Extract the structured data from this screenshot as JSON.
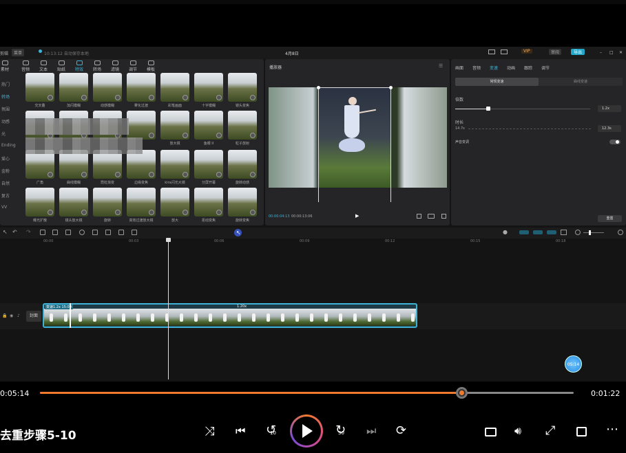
{
  "app": {
    "title": "4月8日",
    "menu": "剪辑",
    "menu_sub": "菜单",
    "autosave": "10:13:12 自动保存本地",
    "vip": "VIP",
    "share": "审阅",
    "export": "导出"
  },
  "library": {
    "tabs": [
      "素材",
      "音频",
      "文本",
      "贴纸",
      "特效",
      "转场",
      "滤镜",
      "调节",
      "模板"
    ],
    "active_tab": 4,
    "categories": [
      "热门",
      "转场",
      "氛围",
      "动感",
      "光",
      "Ending",
      "爱心",
      "金粉",
      "自然",
      "复古",
      "VV"
    ],
    "active_category": 1,
    "rows": [
      [
        "交叉叠",
        "加闪模糊",
        "动感模糊",
        "雾化过渡",
        "彩笔画面",
        "十字模糊",
        "镜头变焦"
      ],
      [
        "",
        "",
        "",
        "",
        "放大镜",
        "鱼眼 II",
        "粒子放射"
      ],
      [
        "广角",
        "曲线模糊",
        "霓虹渐变",
        "边缘变焦",
        "kira闪光大镜",
        "分屏开幕",
        "旋转动感"
      ],
      [
        "曝光扩散",
        "镜头放大镜",
        "旋转",
        "高效过渡放大镜",
        "放大",
        "拒动变焦",
        "旋转变焦"
      ]
    ]
  },
  "player": {
    "title": "播放器",
    "current_time": "00:00:04:13",
    "total_time": "00:00:13:06"
  },
  "right_panel": {
    "tabs": [
      "画面",
      "音频",
      "变速",
      "动画",
      "跟踪",
      "调节"
    ],
    "active_tab": 2,
    "mode_tabs": [
      "常规变速",
      "曲线变速"
    ],
    "speed_label": "倍数",
    "speed_value": "1.2x",
    "duration_label": "时长",
    "duration_from": "14.7s",
    "duration_to": "12.3s",
    "pitch_label": "声音变调",
    "reset_label": "重置"
  },
  "timeline": {
    "ruler": [
      "00:00",
      "00:03",
      "00:06",
      "00:09",
      "00:12",
      "00:15",
      "00:18"
    ],
    "clip_label": "变速1.2x 15:00",
    "speed_badge": "1.20x",
    "cover_label": "封面"
  },
  "media_player": {
    "elapsed": "0:05:14",
    "remaining": "0:01:22",
    "progress": 0.79,
    "title": "去重步骤5-10",
    "cursor_badge": "05:14",
    "skip_back": "10",
    "skip_fwd": "30"
  },
  "colors": {
    "accent": "#f07a2e",
    "editor_accent": "#3fb3d6"
  }
}
